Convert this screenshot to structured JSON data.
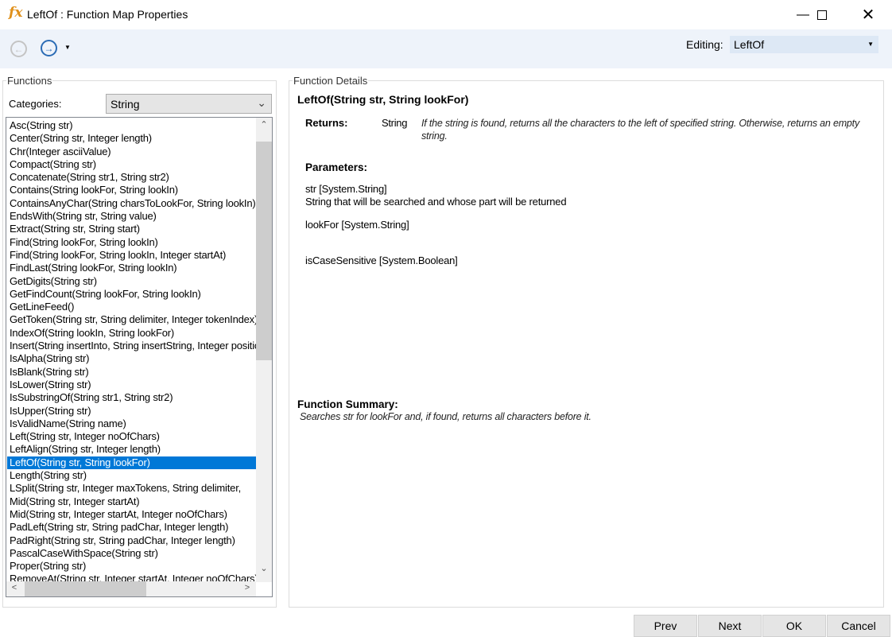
{
  "window": {
    "title": "LeftOf : Function Map Properties",
    "icon": "fx-icon"
  },
  "toolbar": {
    "back_icon": "back-arrow-icon",
    "forward_icon": "forward-arrow-icon",
    "editing_label": "Editing:",
    "editing_value": "LeftOf"
  },
  "functions": {
    "legend": "Functions",
    "categories_label": "Categories:",
    "category": "String",
    "items": [
      "Asc(String str)",
      "Center(String str, Integer length)",
      "Chr(Integer asciiValue)",
      "Compact(String str)",
      "Concatenate(String str1, String str2)",
      "Contains(String lookFor, String lookIn)",
      "ContainsAnyChar(String charsToLookFor, String lookIn)",
      "EndsWith(String str, String value)",
      "Extract(String str, String start)",
      "Find(String lookFor, String lookIn)",
      "Find(String lookFor, String lookIn, Integer startAt)",
      "FindLast(String lookFor, String lookIn)",
      "GetDigits(String str)",
      "GetFindCount(String lookFor, String lookIn)",
      "GetLineFeed()",
      "GetToken(String str, String delimiter, Integer tokenIndex)",
      "IndexOf(String lookIn, String lookFor)",
      "Insert(String insertInto, String insertString, Integer position)",
      "IsAlpha(String str)",
      "IsBlank(String str)",
      "IsLower(String str)",
      "IsSubstringOf(String str1, String str2)",
      "IsUpper(String str)",
      "IsValidName(String name)",
      "Left(String str, Integer noOfChars)",
      "LeftAlign(String str, Integer length)",
      "LeftOf(String str, String lookFor)",
      "Length(String str)",
      "LSplit(String str, Integer maxTokens, String delimiter, ",
      "Mid(String str, Integer startAt)",
      "Mid(String str, Integer startAt, Integer noOfChars)",
      "PadLeft(String str, String padChar, Integer length)",
      "PadRight(String str, String padChar, Integer length)",
      "PascalCaseWithSpace(String str)",
      "Proper(String str)",
      "RemoveAt(String str, Integer startAt, Integer noOfChars)"
    ],
    "selected_index": 26
  },
  "details": {
    "legend": "Function Details",
    "signature": "LeftOf(String str, String lookFor)",
    "returns_label": "Returns:",
    "returns_type": "String",
    "returns_desc": "If the string is found, returns all the characters to the left of specified string. Otherwise, returns an empty string.",
    "parameters_label": "Parameters:",
    "params": [
      {
        "name": "str [System.String]",
        "desc": "String that will be searched and whose part will be returned"
      },
      {
        "name": "lookFor [System.String]",
        "desc": ""
      },
      {
        "name": "isCaseSensitive [System.Boolean]",
        "desc": ""
      }
    ],
    "summary_label": "Function Summary:",
    "summary": "Searches str for lookFor and, if found, returns all characters before it."
  },
  "buttons": {
    "prev": "Prev",
    "next": "Next",
    "ok": "OK",
    "cancel": "Cancel"
  }
}
